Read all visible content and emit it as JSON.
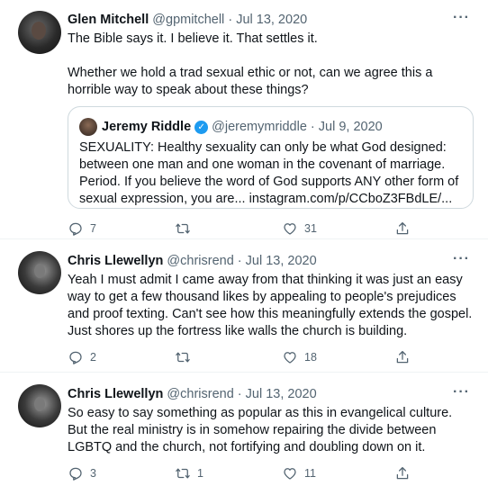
{
  "tweets": [
    {
      "name": "Glen Mitchell",
      "handle": "@gpmitchell",
      "date": "Jul 13, 2020",
      "para1": "The Bible says it. I believe it. That settles it.",
      "para2": "Whether we hold a trad sexual ethic or not, can we agree this a horrible way to speak about these things?",
      "quote": {
        "name": "Jeremy Riddle",
        "handle": "@jeremymriddle",
        "date": "Jul 9, 2020",
        "text": "SEXUALITY: Healthy sexuality can only be what God designed: between one man and one woman in the covenant of marriage. Period. If you believe the word of God supports ANY other form of sexual expression, you are... instagram.com/p/CCboZ3FBdLE/..."
      },
      "replies": "7",
      "retweets": "",
      "likes": "31"
    },
    {
      "name": "Chris Llewellyn",
      "handle": "@chrisrend",
      "date": "Jul 13, 2020",
      "text": "Yeah I must admit I came away from that thinking it was just an easy way to get a few thousand likes by appealing to people's prejudices and proof texting. Can't see how this meaningfully extends the gospel. Just shores up the fortress like walls the church is building.",
      "replies": "2",
      "retweets": "",
      "likes": "18"
    },
    {
      "name": "Chris Llewellyn",
      "handle": "@chrisrend",
      "date": "Jul 13, 2020",
      "text": "So easy to say something as popular as this in evangelical culture. But the real ministry is in somehow repairing the divide between LGBTQ and the church, not fortifying and doubling down on it.",
      "replies": "3",
      "retweets": "1",
      "likes": "11"
    }
  ],
  "separator": "·",
  "more_icon": "···",
  "verified_mark": "✓"
}
